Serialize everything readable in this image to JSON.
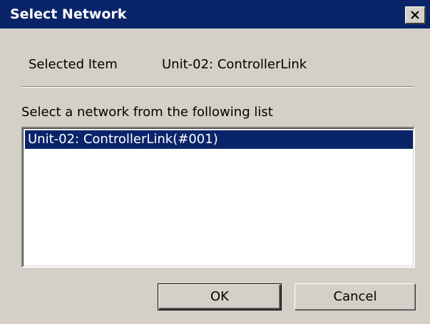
{
  "window": {
    "title": "Select Network",
    "close_glyph": "close-icon"
  },
  "selected": {
    "label": "Selected Item",
    "value": "Unit-02: ControllerLink"
  },
  "instruction": "Select a network from the following list",
  "list": {
    "items": [
      {
        "label": "Unit-02: ControllerLink(#001)",
        "selected": true
      }
    ]
  },
  "buttons": {
    "ok_label": "OK",
    "cancel_label": "Cancel"
  },
  "colors": {
    "titlebar": "#0a246a",
    "face": "#d4d0c8",
    "selection": "#0a246a"
  }
}
